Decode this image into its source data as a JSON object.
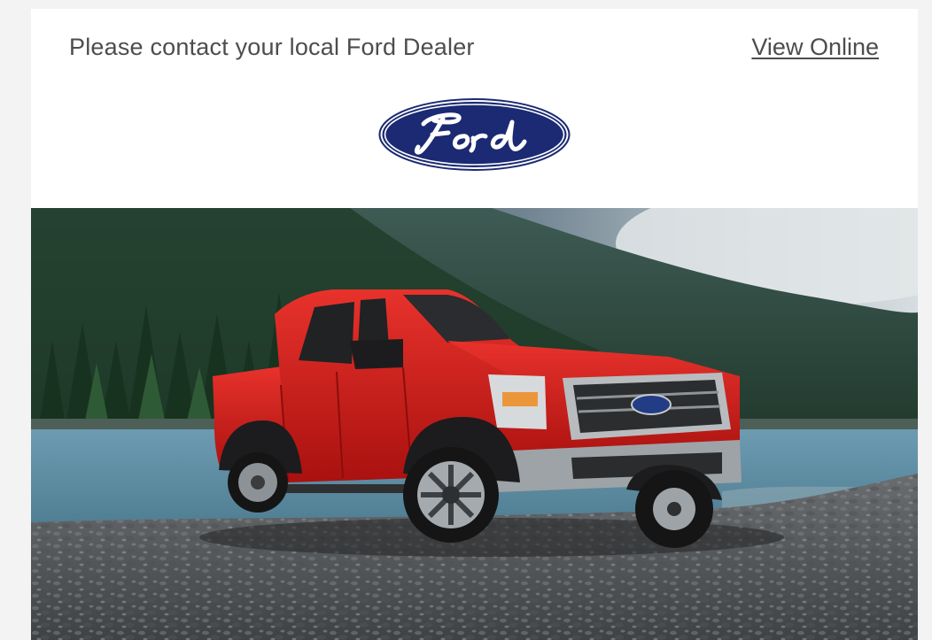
{
  "preheader": {
    "contact_text": "Please contact your local Ford Dealer",
    "view_online_label": "View Online"
  },
  "logo": {
    "brand": "Ford",
    "icon": "ford-oval-logo",
    "color_oval": "#1b2a72",
    "color_text": "#ffffff"
  },
  "hero": {
    "subject": "red Ford pickup truck parked on a rocky lakeshore with forested mountains",
    "colors": {
      "truck": "#d41f1c",
      "water": "#5f8fa5",
      "forest": "#2d4a3b",
      "sky": "#c9d3d8",
      "gravel": "#5b5e61"
    }
  }
}
